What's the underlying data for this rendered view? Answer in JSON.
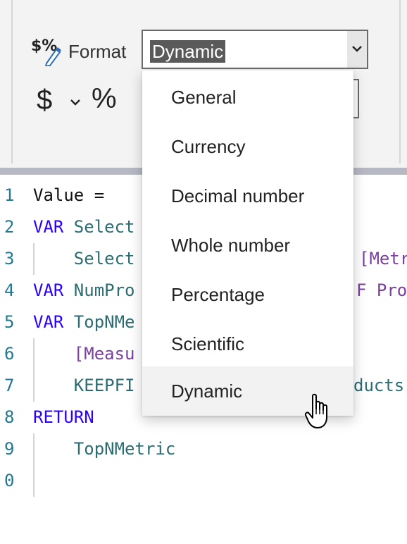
{
  "ribbon": {
    "format_label": "Format",
    "format_value": "Dynamic",
    "currency_symbol": "$",
    "percent_symbol": "%"
  },
  "dropdown": {
    "options": [
      "General",
      "Currency",
      "Decimal number",
      "Whole number",
      "Percentage",
      "Scientific",
      "Dynamic"
    ],
    "hovered": "Dynamic"
  },
  "code": {
    "line_numbers": [
      "1",
      "2",
      "3",
      "4",
      "5",
      "6",
      "7",
      "8",
      "9",
      "0"
    ],
    "lines": [
      {
        "a": "Value ="
      },
      {
        "a": "VAR",
        "b": " Select"
      },
      {
        "a": "    Select",
        "b": "[Metr"
      },
      {
        "a": "VAR",
        "b": " NumPro",
        "c": "F",
        "d": " Prod"
      },
      {
        "a": "VAR",
        "b": " TopNMe"
      },
      {
        "a": "    [Measu"
      },
      {
        "a": "    KEEPFI",
        "b": "ducts"
      },
      {
        "a": "RETURN"
      },
      {
        "a": "    TopNMetric"
      }
    ]
  },
  "colors": {
    "keyword": "#2a00ff",
    "identifier": "#2b6d72",
    "bracket": "#7b3fa0",
    "line_number": "#237893"
  }
}
